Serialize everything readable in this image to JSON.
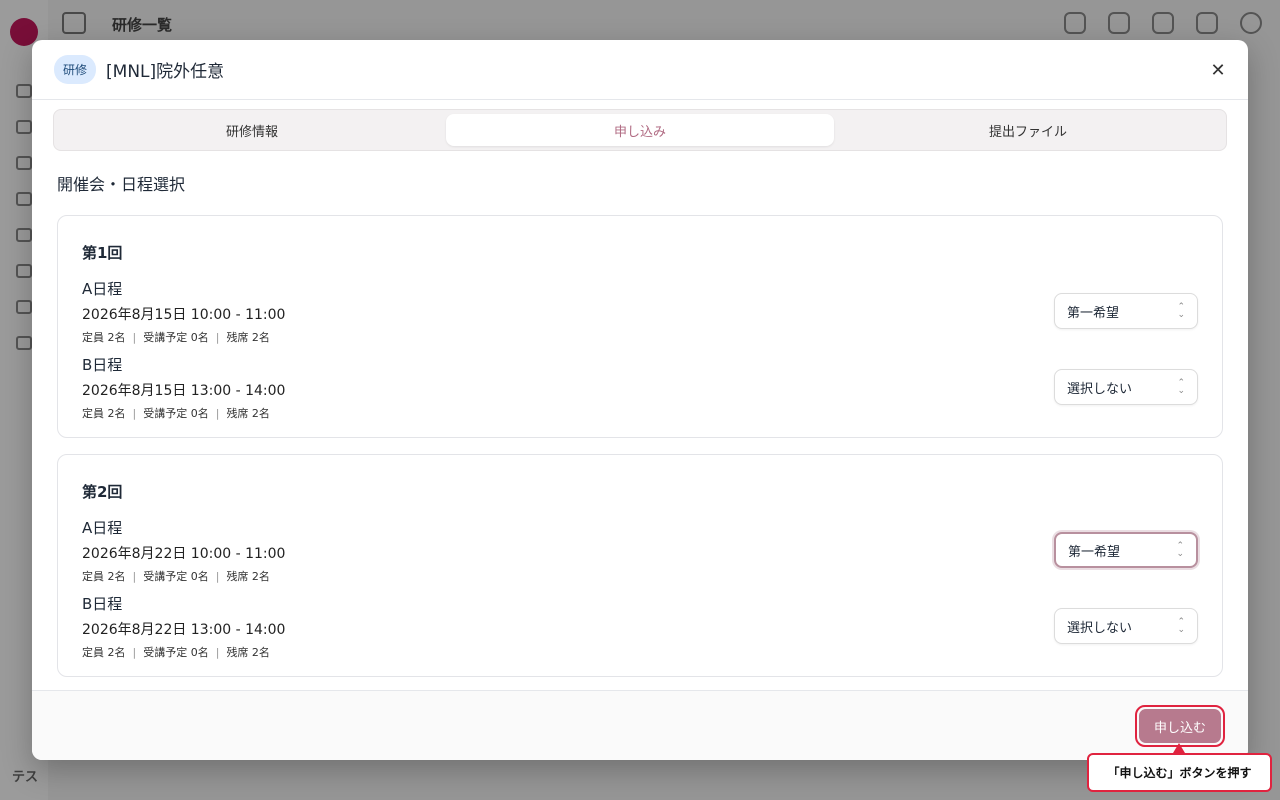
{
  "background": {
    "page_title": "研修一覧",
    "footer_abbr": "テス"
  },
  "modal": {
    "tag": "研修",
    "title": "[MNL]院外任意",
    "tabs": [
      {
        "label": "研修情報",
        "active": false
      },
      {
        "label": "申し込み",
        "active": true
      },
      {
        "label": "提出ファイル",
        "active": false
      }
    ],
    "section_title": "開催会・日程選択",
    "rounds": [
      {
        "title": "第1回",
        "slots": [
          {
            "name": "A日程",
            "datetime": "2026年8月15日 10:00 - 11:00",
            "capacity": "定員 2名",
            "planned": "受講予定 0名",
            "remaining": "残席 2名",
            "selection": "第一希望"
          },
          {
            "name": "B日程",
            "datetime": "2026年8月15日 13:00 - 14:00",
            "capacity": "定員 2名",
            "planned": "受講予定 0名",
            "remaining": "残席 2名",
            "selection": "選択しない"
          }
        ]
      },
      {
        "title": "第2回",
        "slots": [
          {
            "name": "A日程",
            "datetime": "2026年8月22日 10:00 - 11:00",
            "capacity": "定員 2名",
            "planned": "受講予定 0名",
            "remaining": "残席 2名",
            "selection": "第一希望"
          },
          {
            "name": "B日程",
            "datetime": "2026年8月22日 13:00 - 14:00",
            "capacity": "定員 2名",
            "planned": "受講予定 0名",
            "remaining": "残席 2名",
            "selection": "選択しない"
          }
        ]
      }
    ],
    "submit_label": "申し込む"
  },
  "annotation": {
    "hint_text": "「申し込む」ボタンを押す"
  },
  "colors": {
    "accent": "#b77a8e",
    "highlight": "#e0233f"
  }
}
